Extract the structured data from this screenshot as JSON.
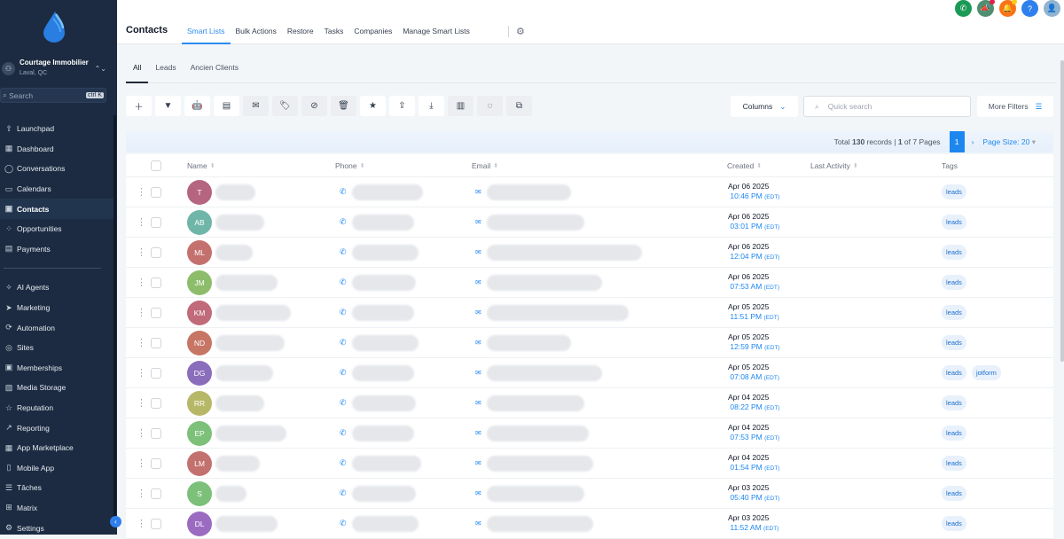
{
  "colors": {
    "sidebar": "#1c2b41",
    "accent": "#1d87f0"
  },
  "sidebar": {
    "account": {
      "name": "Courtage Immobilier",
      "location": "Laval, QC"
    },
    "search": {
      "placeholder": "Search",
      "shortcut": "ctrl K"
    },
    "items": [
      {
        "label": "Launchpad",
        "icon": "rocket-icon"
      },
      {
        "label": "Dashboard",
        "icon": "grid-icon"
      },
      {
        "label": "Conversations",
        "icon": "chat-icon"
      },
      {
        "label": "Calendars",
        "icon": "calendar-icon"
      },
      {
        "label": "Contacts",
        "icon": "contacts-icon",
        "active": true
      },
      {
        "label": "Opportunities",
        "icon": "opportunities-icon"
      },
      {
        "label": "Payments",
        "icon": "payments-icon"
      }
    ],
    "items2": [
      {
        "label": "AI Agents",
        "icon": "sparkle-icon"
      },
      {
        "label": "Marketing",
        "icon": "send-icon"
      },
      {
        "label": "Automation",
        "icon": "automation-icon"
      },
      {
        "label": "Sites",
        "icon": "globe-icon"
      },
      {
        "label": "Memberships",
        "icon": "membership-icon"
      },
      {
        "label": "Media Storage",
        "icon": "image-icon"
      },
      {
        "label": "Reputation",
        "icon": "star-icon"
      },
      {
        "label": "Reporting",
        "icon": "chart-icon"
      },
      {
        "label": "App Marketplace",
        "icon": "apps-icon"
      },
      {
        "label": "Mobile App",
        "icon": "mobile-icon"
      },
      {
        "label": "Tâches",
        "icon": "tasks-icon"
      },
      {
        "label": "Matrix",
        "icon": "matrix-icon"
      },
      {
        "label": "Settings",
        "icon": "gear-icon"
      }
    ]
  },
  "header": {
    "title": "Contacts",
    "tabs": [
      "Smart Lists",
      "Bulk Actions",
      "Restore",
      "Tasks",
      "Companies",
      "Manage Smart Lists"
    ]
  },
  "subtabs": [
    "All",
    "Leads",
    "Ancien Clients"
  ],
  "toolbar": {
    "columns_label": "Columns",
    "search_placeholder": "Quick search",
    "more_filters": "More Filters"
  },
  "pagination": {
    "total_prefix": "Total ",
    "total": "130",
    "total_suffix": " records | ",
    "page": "1",
    "of_pages": " of 7 Pages",
    "current": "1",
    "page_size": "Page Size: 20"
  },
  "table": {
    "columns": [
      "Name",
      "Phone",
      "Email",
      "Created",
      "Last Activity",
      "Tags"
    ],
    "rows": [
      {
        "initials": "T",
        "color": "#b5657f",
        "date": "Apr 06 2025",
        "time": "10:46 PM",
        "tz": "(EDT)",
        "tags": [
          "leads"
        ]
      },
      {
        "initials": "AB",
        "color": "#6fb6a8",
        "date": "Apr 06 2025",
        "time": "03:01 PM",
        "tz": "(EDT)",
        "tags": [
          "leads"
        ]
      },
      {
        "initials": "ML",
        "color": "#c4716e",
        "date": "Apr 06 2025",
        "time": "12:04 PM",
        "tz": "(EDT)",
        "tags": [
          "leads"
        ]
      },
      {
        "initials": "JM",
        "color": "#8dbd6a",
        "date": "Apr 06 2025",
        "time": "07:53 AM",
        "tz": "(EDT)",
        "tags": [
          "leads"
        ]
      },
      {
        "initials": "KM",
        "color": "#c06a7a",
        "date": "Apr 05 2025",
        "time": "11:51 PM",
        "tz": "(EDT)",
        "tags": [
          "leads"
        ]
      },
      {
        "initials": "ND",
        "color": "#c77565",
        "date": "Apr 05 2025",
        "time": "12:59 PM",
        "tz": "(EDT)",
        "tags": [
          "leads"
        ]
      },
      {
        "initials": "DG",
        "color": "#8a6dbb",
        "date": "Apr 05 2025",
        "time": "07:08 AM",
        "tz": "(EDT)",
        "tags": [
          "leads",
          "jotform"
        ]
      },
      {
        "initials": "RR",
        "color": "#b7b867",
        "date": "Apr 04 2025",
        "time": "08:22 PM",
        "tz": "(EDT)",
        "tags": [
          "leads"
        ]
      },
      {
        "initials": "EP",
        "color": "#7cc07a",
        "date": "Apr 04 2025",
        "time": "07:53 PM",
        "tz": "(EDT)",
        "tags": [
          "leads"
        ]
      },
      {
        "initials": "LM",
        "color": "#c3716e",
        "date": "Apr 04 2025",
        "time": "01:54 PM",
        "tz": "(EDT)",
        "tags": [
          "leads"
        ]
      },
      {
        "initials": "S",
        "color": "#7cc07a",
        "date": "Apr 03 2025",
        "time": "05:40 PM",
        "tz": "(EDT)",
        "tags": [
          "leads"
        ]
      },
      {
        "initials": "DL",
        "color": "#9a6bc0",
        "date": "Apr 03 2025",
        "time": "11:52 AM",
        "tz": "(EDT)",
        "tags": [
          "leads"
        ]
      }
    ]
  }
}
